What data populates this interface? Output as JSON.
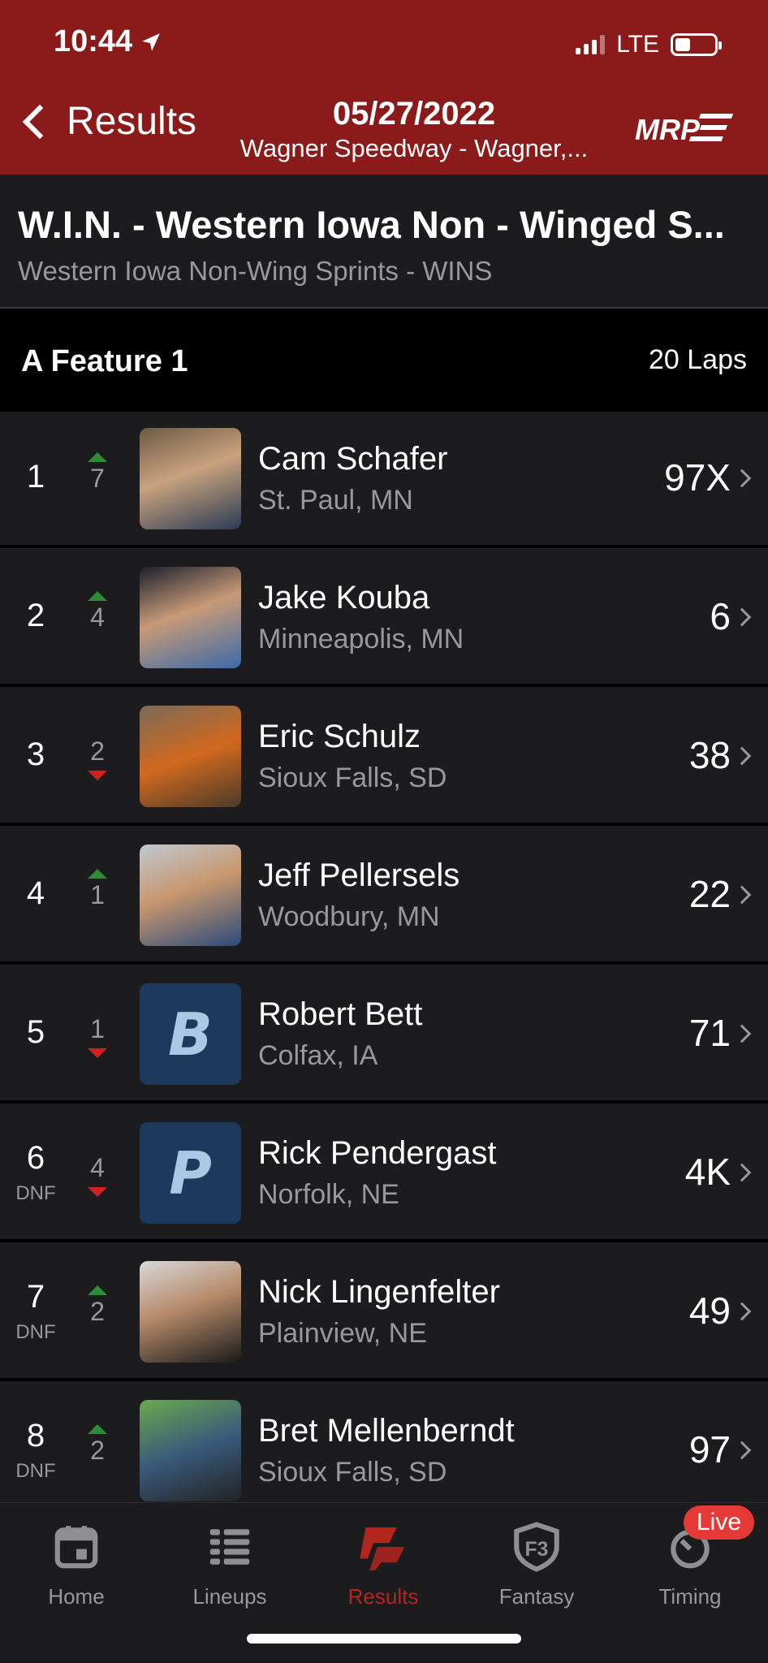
{
  "status_bar": {
    "time": "10:44",
    "network": "LTE"
  },
  "nav": {
    "back_label": "Results",
    "date": "05/27/2022",
    "venue": "Wagner Speedway - Wagner,...",
    "logo_text": "MRP"
  },
  "series": {
    "title": "W.I.N. - Western Iowa Non - Winged S...",
    "subtitle": "Western Iowa Non-Wing Sprints - WINS"
  },
  "event": {
    "name": "A Feature 1",
    "laps": "20 Laps"
  },
  "results": [
    {
      "pos": "1",
      "status": "",
      "change": "7",
      "dir": "up",
      "name": "Cam Schafer",
      "location": "St. Paul, MN",
      "car": "97X",
      "photo": "photo",
      "initial": ""
    },
    {
      "pos": "2",
      "status": "",
      "change": "4",
      "dir": "up",
      "name": "Jake Kouba",
      "location": "Minneapolis, MN",
      "car": "6",
      "photo": "photo",
      "initial": ""
    },
    {
      "pos": "3",
      "status": "",
      "change": "2",
      "dir": "down",
      "name": "Eric Schulz",
      "location": "Sioux Falls, SD",
      "car": "38",
      "photo": "photo",
      "initial": ""
    },
    {
      "pos": "4",
      "status": "",
      "change": "1",
      "dir": "up",
      "name": "Jeff Pellersels",
      "location": "Woodbury, MN",
      "car": "22",
      "photo": "photo",
      "initial": ""
    },
    {
      "pos": "5",
      "status": "",
      "change": "1",
      "dir": "down",
      "name": "Robert Bett",
      "location": "Colfax, IA",
      "car": "71",
      "photo": "placeholder",
      "initial": "B"
    },
    {
      "pos": "6",
      "status": "DNF",
      "change": "4",
      "dir": "down",
      "name": "Rick Pendergast",
      "location": "Norfolk, NE",
      "car": "4K",
      "photo": "placeholder",
      "initial": "P"
    },
    {
      "pos": "7",
      "status": "DNF",
      "change": "2",
      "dir": "up",
      "name": "Nick Lingenfelter",
      "location": "Plainview, NE",
      "car": "49",
      "photo": "photo",
      "initial": ""
    },
    {
      "pos": "8",
      "status": "DNF",
      "change": "2",
      "dir": "up",
      "name": "Bret Mellenberndt",
      "location": "Sioux Falls, SD",
      "car": "97",
      "photo": "photo",
      "initial": ""
    }
  ],
  "tabs": [
    {
      "label": "Home",
      "icon": "calendar-icon",
      "active": false
    },
    {
      "label": "Lineups",
      "icon": "list-icon",
      "active": false
    },
    {
      "label": "Results",
      "icon": "results-flag-icon",
      "active": true
    },
    {
      "label": "Fantasy",
      "icon": "fantasy-shield-icon",
      "active": false
    },
    {
      "label": "Timing",
      "icon": "stopwatch-icon",
      "active": false
    }
  ],
  "live_badge": "Live",
  "colors": {
    "header_bg": "#8b1a1a",
    "accent": "#b3261e",
    "up": "#2e8b3a",
    "down": "#d12020"
  }
}
